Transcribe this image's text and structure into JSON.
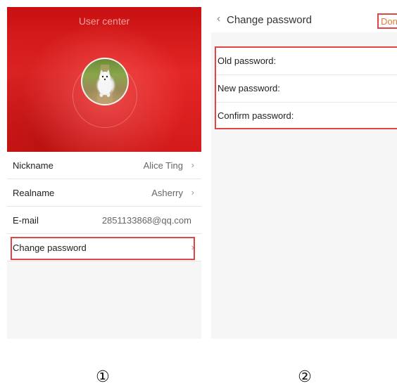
{
  "screen1": {
    "header_title": "User center",
    "avatar_icon": "dog-photo-avatar",
    "rows": [
      {
        "label": "Nickname",
        "value": "Alice Ting",
        "arrow": "›"
      },
      {
        "label": "Realname",
        "value": "Asherry",
        "arrow": "›"
      },
      {
        "label": "E-mail",
        "value": "2851133868@qq.com"
      },
      {
        "label": "Change password",
        "value": "",
        "arrow": "›"
      }
    ]
  },
  "screen2": {
    "back_glyph": "<",
    "title": "Change password",
    "done_label": "Done",
    "fields": [
      {
        "label": "Old password:",
        "value": ""
      },
      {
        "label": "New password:",
        "value": ""
      },
      {
        "label": "Confirm password:",
        "value": ""
      }
    ]
  },
  "captions": [
    "①",
    "②"
  ],
  "colors": {
    "highlight": "#e04545",
    "hero_red": "#e32626",
    "done_text": "#e07a3a"
  }
}
